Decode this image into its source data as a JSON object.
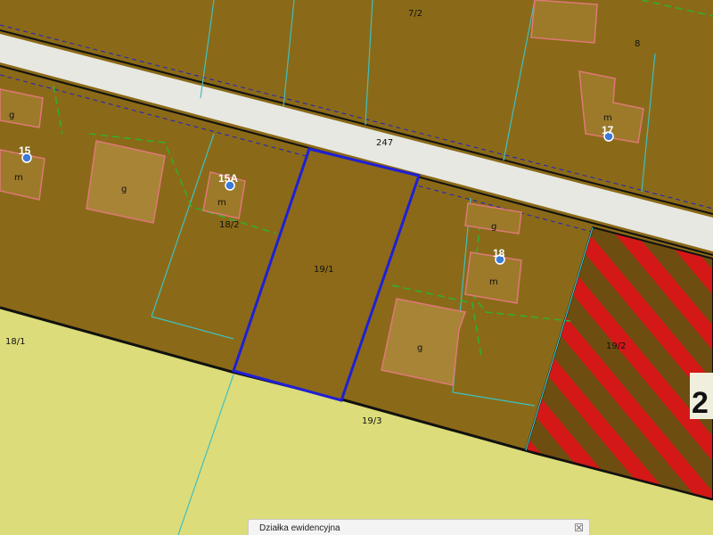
{
  "map": {
    "road_label": "247",
    "parcels": {
      "p7_2": "7/2",
      "p8": "8",
      "p18_2": "18/2",
      "p19_1": "19/1",
      "p18_1": "18/1",
      "p19_3": "19/3",
      "p19_2": "19/2"
    },
    "building_labels": {
      "g_left_top": "g",
      "m_left": "m",
      "g_left": "g",
      "m_15a": "m",
      "g_right_top": "g",
      "m_18": "m",
      "g_right": "g",
      "m_17": "m"
    },
    "addresses": {
      "a15": "15",
      "a15a": "15A",
      "a17": "17",
      "a18": "18"
    },
    "cut_number": "2"
  },
  "popup": {
    "title": "Działka ewidencyjna",
    "close_icon": "close-icon"
  },
  "colors": {
    "built_area": "#8a6a18",
    "field": "#dcdc7a",
    "road": "#e6e6e0",
    "selected_parcel": "#1f1fd6",
    "hatch_red": "#d41818",
    "building_outline": "#e07878",
    "parcel_line": "#40c0c0",
    "green_dash": "#30b030",
    "address_dot": "#3a7ad8"
  }
}
